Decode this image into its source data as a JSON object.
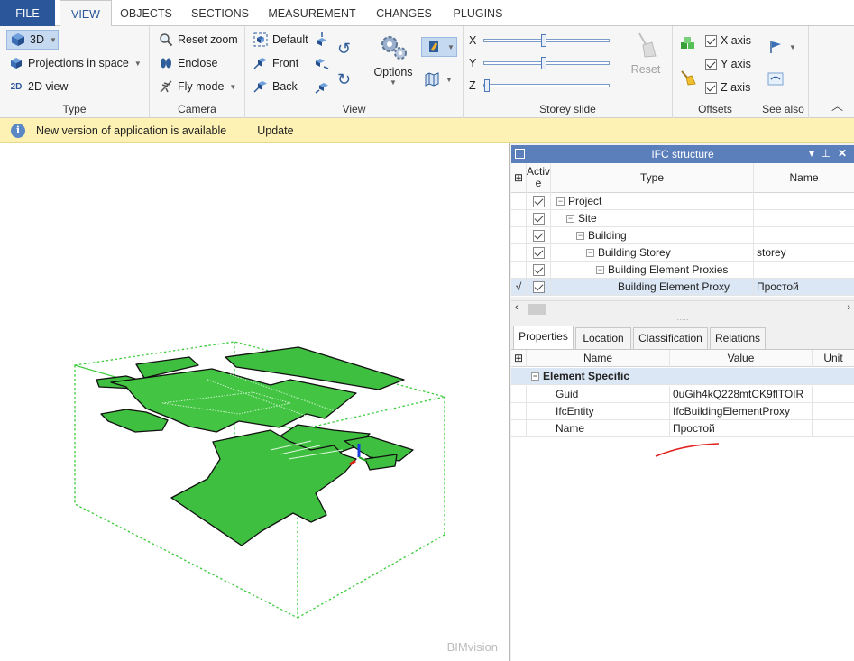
{
  "tabs": [
    "FILE",
    "VIEW",
    "OBJECTS",
    "SECTIONS",
    "MEASUREMENT",
    "CHANGES",
    "PLUGINS"
  ],
  "ribbon": {
    "type": {
      "label": "Type",
      "btn_3d": "3D",
      "btn_projections": "Projections in space",
      "btn_2d": "2D view",
      "icon_2d": "2D"
    },
    "camera": {
      "label": "Camera",
      "reset_zoom": "Reset zoom",
      "enclose": "Enclose",
      "fly_mode": "Fly mode"
    },
    "view": {
      "label": "View",
      "default": "Default",
      "front": "Front",
      "back": "Back",
      "options": "Options"
    },
    "storey": {
      "label": "Storey slide",
      "x": "X",
      "y": "Y",
      "z": "Z",
      "reset": "Reset",
      "x_value": 0.48,
      "y_value": 0.48,
      "z_value": 0.0
    },
    "offsets": {
      "label": "Offsets",
      "x_axis": "X axis",
      "y_axis": "Y axis",
      "z_axis": "Z axis"
    },
    "see_also": {
      "label": "See also"
    }
  },
  "notice": {
    "text": "New version of application is available",
    "action": "Update"
  },
  "viewport": {
    "brand": "BIMvision"
  },
  "ifc": {
    "title": "IFC structure",
    "col_active": "Active",
    "col_type": "Type",
    "col_name": "Name",
    "rows": [
      {
        "type": "Project",
        "name": ""
      },
      {
        "type": "Site",
        "name": ""
      },
      {
        "type": "Building",
        "name": ""
      },
      {
        "type": "Building Storey",
        "name": "storey"
      },
      {
        "type": "Building Element Proxies",
        "name": ""
      },
      {
        "type": "Building Element Proxy",
        "name": "Простой",
        "marker": "√"
      }
    ]
  },
  "props": {
    "tabs": [
      "Properties",
      "Location",
      "Classification",
      "Relations"
    ],
    "col_name": "Name",
    "col_value": "Value",
    "col_unit": "Unit",
    "group": "Element Specific",
    "rows": [
      {
        "name": "Guid",
        "value": "0uGih4kQ228mtCK9flTOIR"
      },
      {
        "name": "IfcEntity",
        "value": "IfcBuildingElementProxy"
      },
      {
        "name": "Name",
        "value": "Простой"
      }
    ]
  },
  "colors": {
    "accent": "#2b579a",
    "model_fill": "#3fbf3f",
    "panel_header": "#5b7fba",
    "notice_bg": "#fdf2b3",
    "annotation": "#e0201c"
  }
}
